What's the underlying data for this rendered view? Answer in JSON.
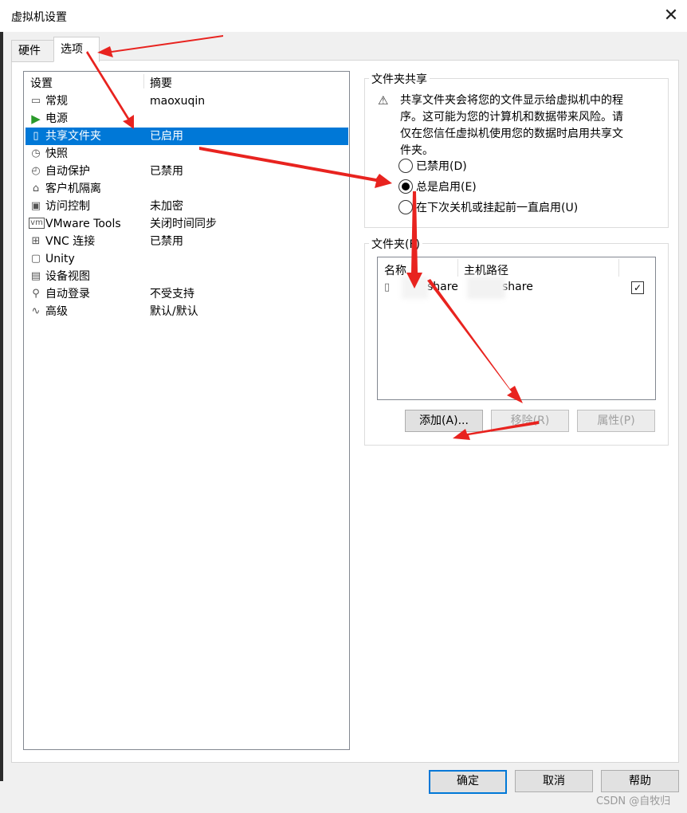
{
  "window": {
    "title": "虚拟机设置",
    "close_glyph": "✕"
  },
  "tabs": [
    {
      "label": "硬件"
    },
    {
      "label": "选项"
    }
  ],
  "settings_list": {
    "header": {
      "setting": "设置",
      "summary": "摘要"
    },
    "items": [
      {
        "name": "常规",
        "summary": "maoxuqin",
        "icon": "monitor-icon",
        "glyph": "▭"
      },
      {
        "name": "电源",
        "summary": "",
        "icon": "play-icon",
        "glyph": "▶"
      },
      {
        "name": "共享文件夹",
        "summary": "已启用",
        "icon": "shared-folder-icon",
        "glyph": "▯",
        "selected": true
      },
      {
        "name": "快照",
        "summary": "",
        "icon": "snapshot-icon",
        "glyph": "◷"
      },
      {
        "name": "自动保护",
        "summary": "已禁用",
        "icon": "clock-icon",
        "glyph": "◴"
      },
      {
        "name": "客户机隔离",
        "summary": "",
        "icon": "lock-icon",
        "glyph": "⌂"
      },
      {
        "name": "访问控制",
        "summary": "未加密",
        "icon": "access-control-icon",
        "glyph": "▣"
      },
      {
        "name": "VMware Tools",
        "summary": "关闭时间同步",
        "icon": "vm-icon",
        "glyph": "vm"
      },
      {
        "name": "VNC 连接",
        "summary": "已禁用",
        "icon": "vnc-icon",
        "glyph": "⊞"
      },
      {
        "name": "Unity",
        "summary": "",
        "icon": "unity-icon",
        "glyph": "▢"
      },
      {
        "name": "设备视图",
        "summary": "",
        "icon": "device-view-icon",
        "glyph": "▤"
      },
      {
        "name": "自动登录",
        "summary": "不受支持",
        "icon": "auto-login-icon",
        "glyph": "⚲"
      },
      {
        "name": "高级",
        "summary": "默认/默认",
        "icon": "advanced-icon",
        "glyph": "∿"
      }
    ]
  },
  "folder_sharing": {
    "group_label": "文件夹共享",
    "warning_icon": "warning-icon",
    "warning_glyph": "⚠",
    "description": "共享文件夹会将您的文件显示给虚拟机中的程序。这可能为您的计算机和数据带来风险。请仅在您信任虚拟机使用您的数据时启用共享文件夹。",
    "options": [
      {
        "label": "已禁用(D)",
        "checked": false
      },
      {
        "label": "总是启用(E)",
        "checked": true
      },
      {
        "label": "在下次关机或挂起前一直启用(U)",
        "checked": false
      }
    ]
  },
  "folders": {
    "group_label": "文件夹(F)",
    "columns": {
      "name": "名称",
      "host_path": "主机路径"
    },
    "rows": [
      {
        "name": "share",
        "host_path": "share",
        "enabled_glyph": "✓"
      }
    ],
    "buttons": {
      "add": "添加(A)...",
      "remove": "移除(R)",
      "properties": "属性(P)"
    }
  },
  "footer_buttons": {
    "ok": "确定",
    "cancel": "取消",
    "help": "帮助"
  },
  "watermark": "CSDN @自牧归",
  "colors": {
    "selection": "#0078d7",
    "annotation_arrow": "#e8231f"
  }
}
